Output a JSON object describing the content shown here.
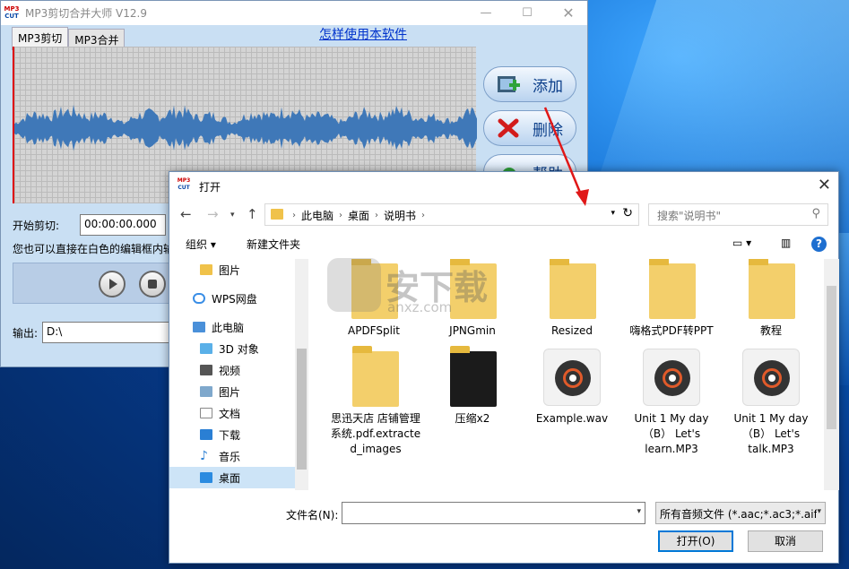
{
  "app": {
    "logo_top": "MP3",
    "logo_bottom": "CUT",
    "title": "MP3剪切合并大师 V12.9",
    "tabs": [
      "MP3剪切",
      "MP3合并"
    ],
    "help_link": "怎样使用本软件",
    "buttons": {
      "add": "添加",
      "delete": "删除",
      "help": "帮助"
    },
    "start_label": "开始剪切:",
    "start_value": "00:00:00.000",
    "hint": "您也可以直接在白色的编辑框内输",
    "output_label": "输出:",
    "output_value": "D:\\"
  },
  "dialog": {
    "title": "打开",
    "breadcrumbs": [
      "此电脑",
      "桌面",
      "说明书"
    ],
    "search_placeholder": "搜索\"说明书\"",
    "toolbar": {
      "organize": "组织 ▾",
      "new_folder": "新建文件夹"
    },
    "sidebar": [
      {
        "label": "图片",
        "icon": "folder-icon"
      },
      {
        "label": "WPS网盘",
        "icon": "cloud-icon"
      },
      {
        "label": "此电脑",
        "icon": "computer-icon"
      },
      {
        "label": "3D 对象",
        "icon": "cube-icon"
      },
      {
        "label": "视频",
        "icon": "video-icon"
      },
      {
        "label": "图片",
        "icon": "picture-icon"
      },
      {
        "label": "文档",
        "icon": "document-icon"
      },
      {
        "label": "下载",
        "icon": "download-icon"
      },
      {
        "label": "音乐",
        "icon": "music-icon"
      },
      {
        "label": "桌面",
        "icon": "desktop-icon"
      }
    ],
    "files": [
      {
        "name": "APDFSplit",
        "type": "folder"
      },
      {
        "name": "JPNGmin",
        "type": "folder"
      },
      {
        "name": "Resized",
        "type": "folder"
      },
      {
        "name": "嗨格式PDF转PPT",
        "type": "folder"
      },
      {
        "name": "教程",
        "type": "folder"
      },
      {
        "name": "思迅天店 店铺管理系统.pdf.extracted_images",
        "type": "folder"
      },
      {
        "name": "压缩x2",
        "type": "folder"
      },
      {
        "name": "Example.wav",
        "type": "audio"
      },
      {
        "name": "Unit 1 My day （B） Let's learn.MP3",
        "type": "audio"
      },
      {
        "name": "Unit 1 My day （B） Let's talk.MP3",
        "type": "audio"
      }
    ],
    "filename_label": "文件名(N):",
    "filename_value": "",
    "filter": "所有音频文件 (*.aac;*.ac3;*.aif",
    "open_button": "打开(O)",
    "cancel_button": "取消"
  },
  "watermark": {
    "text": "安下载",
    "sub": "anxz.com"
  }
}
